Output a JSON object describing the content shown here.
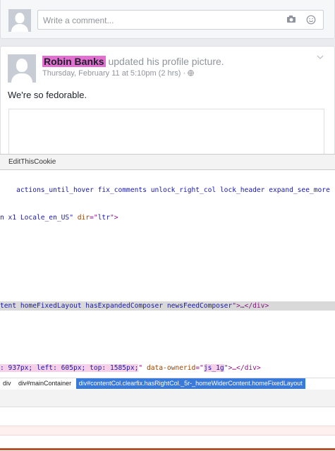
{
  "feed": {
    "comment_placeholder": "Write a comment...",
    "post": {
      "author": "Robin Banks",
      "action": "updated his profile picture.",
      "timestamp": "Thursday, February 11 at 5:10pm (2 hrs) · ",
      "text": "We're so fedorable."
    }
  },
  "devtools": {
    "extension_tab": "EditThisCookie",
    "lines": {
      "l1": "actions_until_hover fix_comments unlock_right_col lock_header expand_see_more",
      "l2_pre": "n x1 Locale_en_US\" ",
      "l2_attr": "dir",
      "l2_eq": "=\"",
      "l2_val": "ltr",
      "l2_post": "\">",
      "l3_val": "tent homeFixedLayout hasExpandedComposer newsFeedComposer",
      "l3_post": "\">…</div>",
      "l4_style": ": 937px; left: 605px; top: 1585px;",
      "l4_attr": " data-ownerid",
      "l4_eq": "=\"",
      "l4_val": "js_1g",
      "l4_post": "\">…</div>"
    },
    "breadcrumbs": [
      "div",
      "div#mainContainer",
      "div#contentCol.clearfix.hasRightCol._5r-_homeWiderContent.homeFixedLayout"
    ]
  }
}
